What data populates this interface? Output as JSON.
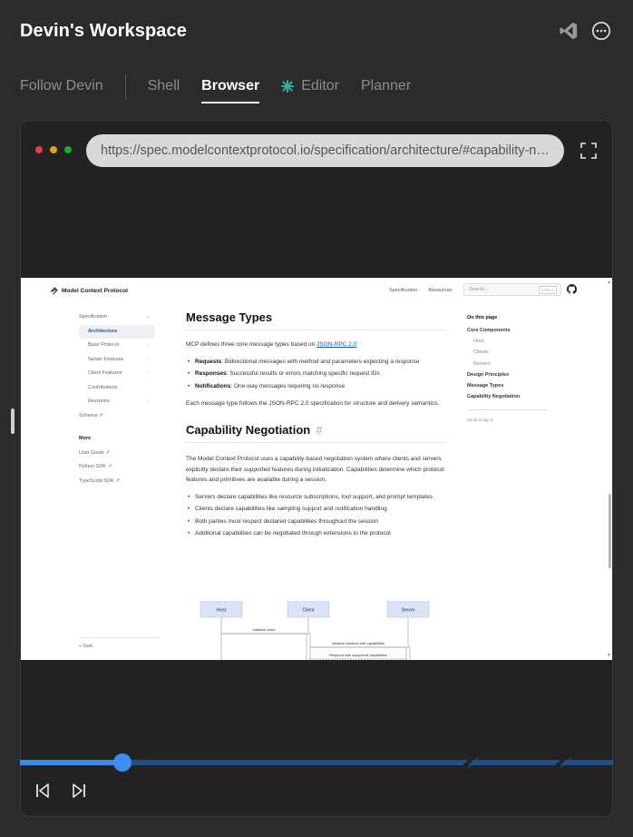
{
  "header": {
    "title": "Devin's Workspace",
    "vscode_icon": "vscode-icon",
    "more_icon": "more-horizontal-icon"
  },
  "tabs": [
    {
      "label": "Follow Devin",
      "active": false
    },
    {
      "label": "Shell",
      "active": false
    },
    {
      "label": "Browser",
      "active": true
    },
    {
      "label": "Editor",
      "active": false,
      "icon": "editor-icon"
    },
    {
      "label": "Planner",
      "active": false
    }
  ],
  "browser": {
    "dots": [
      "#e0443e",
      "#dea123",
      "#1aab29"
    ],
    "url": "https://spec.modelcontextprotocol.io/specification/architecture/#capability-negotiation"
  },
  "page": {
    "site_name": "Model Context Protocol",
    "top_links": [
      "Specification",
      "Resources"
    ],
    "search_placeholder": "Search...",
    "search_kbd": "CTRL K",
    "left_nav": {
      "items": [
        {
          "label": "Specification",
          "level": 0,
          "chevron": "⌄"
        },
        {
          "label": "Architecture",
          "level": 1,
          "active": true
        },
        {
          "label": "Base Protocol",
          "level": 1,
          "chevron": "›"
        },
        {
          "label": "Server Features",
          "level": 1,
          "chevron": "›"
        },
        {
          "label": "Client Features",
          "level": 1,
          "chevron": "›"
        },
        {
          "label": "Contributions",
          "level": 1
        },
        {
          "label": "Revisions",
          "level": 1,
          "chevron": "›"
        },
        {
          "label": "Schema ↗",
          "level": 0
        }
      ],
      "more_heading": "More",
      "more_items": [
        "User Guide ↗",
        "Python SDK ↗",
        "TypeScript SDK ↗"
      ],
      "dark_toggle": "Dark"
    },
    "content": {
      "h_message_types": "Message Types",
      "p1_before": "MCP defines three core message types based on ",
      "p1_link": "JSON-RPC 2.0",
      "p1_after": ":",
      "bullets1": [
        {
          "term": "Requests",
          "text": ": Bidirectional messages with method and parameters expecting a response"
        },
        {
          "term": "Responses",
          "text": ": Successful results or errors matching specific request IDs"
        },
        {
          "term": "Notifications",
          "text": ": One-way messages requiring no response"
        }
      ],
      "p2": "Each message type follows the JSON-RPC 2.0 specification for structure and delivery semantics.",
      "h_capability": "Capability Negotiation",
      "hash": "#",
      "p3": "The Model Context Protocol uses a capability-based negotiation system where clients and servers explicitly declare their supported features during initialization. Capabilities determine which protocol features and primitives are available during a session.",
      "bullets2": [
        "Servers declare capabilities like resource subscriptions, tool support, and prompt templates",
        "Clients declare capabilities like sampling support and notification handling",
        "Both parties must respect declared capabilities throughout the session",
        "Additional capabilities can be negotiated through extensions to the protocol"
      ],
      "diagram": {
        "participants": [
          "Host",
          "Client",
          "Server"
        ],
        "messages": [
          "Initialize client",
          "Initialize session with capabilities",
          "Respond with supported capabilities"
        ]
      }
    },
    "toc": {
      "title": "On this page",
      "items": [
        {
          "label": "Core Components",
          "level": 0
        },
        {
          "label": "Host",
          "level": 1
        },
        {
          "label": "Clients",
          "level": 1
        },
        {
          "label": "Servers",
          "level": 1
        },
        {
          "label": "Design Principles",
          "level": 0
        },
        {
          "label": "Message Types",
          "level": 0
        },
        {
          "label": "Capability Negotiation",
          "level": 0
        }
      ],
      "scroll_to_top": "Scroll to top ⊙"
    }
  },
  "playback": {
    "progress": 0.173,
    "accent": "#3d8ef0",
    "track": "#1e4f86"
  }
}
